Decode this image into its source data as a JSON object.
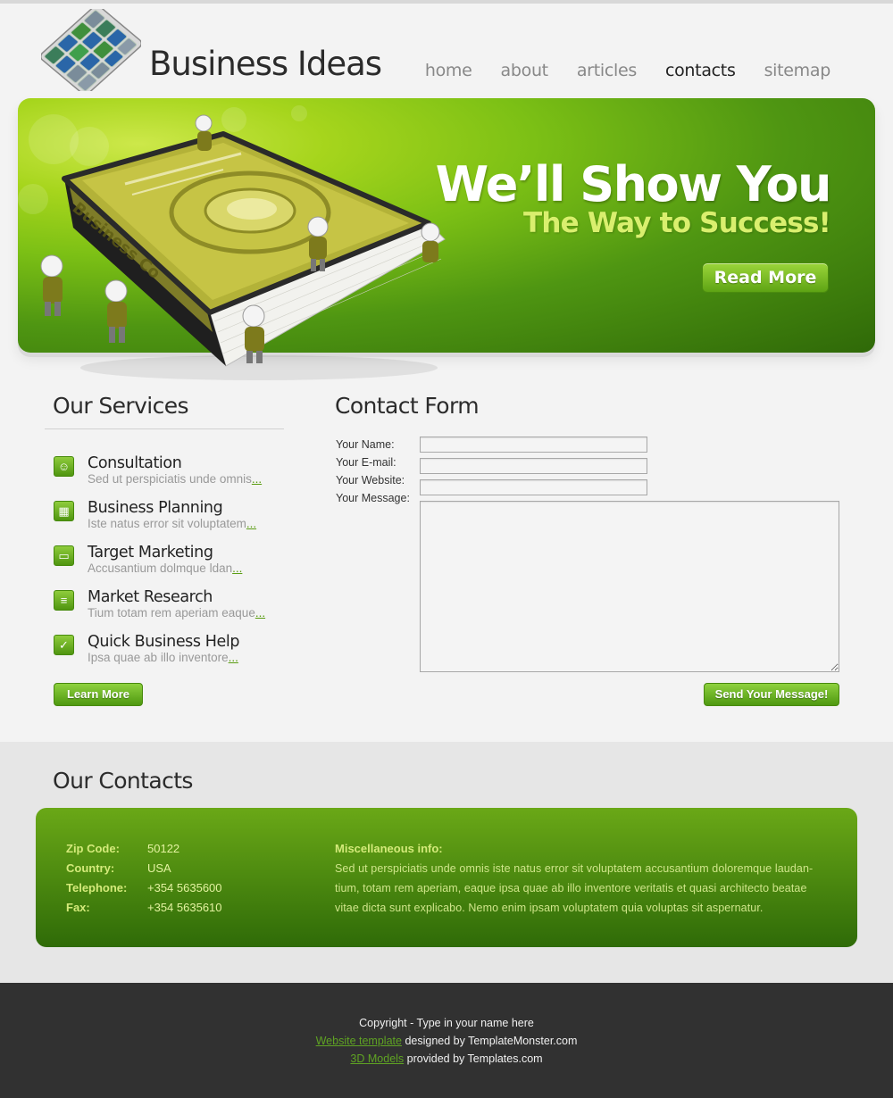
{
  "header": {
    "brand": "Business Ideas",
    "nav": [
      {
        "label": "home"
      },
      {
        "label": "about"
      },
      {
        "label": "articles"
      },
      {
        "label": "contacts",
        "active": true
      },
      {
        "label": "sitemap"
      }
    ]
  },
  "banner": {
    "headline": "We’ll Show You",
    "subheadline": "The Way to Success!",
    "cta_label": "Read More",
    "book_cover_text": "Business Co"
  },
  "services": {
    "title": "Our Services",
    "items": [
      {
        "icon": "person-icon",
        "title": "Consultation",
        "desc": "Sed ut perspiciatis unde omnis",
        "more": "..."
      },
      {
        "icon": "calendar-icon",
        "title": "Business Planning",
        "desc": "Iste natus error sit voluptatem",
        "more": "..."
      },
      {
        "icon": "monitor-icon",
        "title": "Target Marketing",
        "desc": "Accusantium dolmque ldan",
        "more": "..."
      },
      {
        "icon": "document-icon",
        "title": "Market Research",
        "desc": "Tium totam rem aperiam eaque",
        "more": "..."
      },
      {
        "icon": "handshake-icon",
        "title": "Quick Business Help",
        "desc": "Ipsa quae ab illo inventore",
        "more": "..."
      }
    ],
    "learn_more_label": "Learn More"
  },
  "contact_form": {
    "title": "Contact Form",
    "name_label": "Your Name:",
    "email_label": "Your E-mail:",
    "website_label": "Your Website:",
    "message_label": "Your Message:",
    "name_value": "",
    "email_value": "",
    "website_value": "",
    "message_value": "",
    "submit_label": "Send Your Message!"
  },
  "contacts": {
    "title": "Our Contacts",
    "zip_label": "Zip Code:",
    "zip_value": "50122",
    "country_label": "Country:",
    "country_value": "USA",
    "phone_label": "Telephone:",
    "phone_value": "+354 5635600",
    "fax_label": "Fax:",
    "fax_value": "+354 5635610",
    "misc_title": "Miscellaneous info:",
    "misc_lines": [
      "Sed ut perspiciatis unde omnis iste natus error sit voluptatem accusantium doloremque laudan-",
      "tium, totam rem aperiam, eaque ipsa quae ab illo inventore veritatis et quasi architecto beatae",
      "vitae dicta sunt explicabo. Nemo enim ipsam voluptatem quia voluptas sit aspernatur."
    ]
  },
  "footer": {
    "copyright": "Copyright - Type in your name here",
    "template_link": "Website template",
    "template_suffix": " designed by TemplateMonster.com",
    "models_link": "3D Models",
    "models_suffix": " provided by Templates.com"
  },
  "colors": {
    "accent_green": "#5ea414",
    "banner_dark": "#2f6908",
    "banner_light": "#a6d51c",
    "footer_bg": "#313131"
  }
}
